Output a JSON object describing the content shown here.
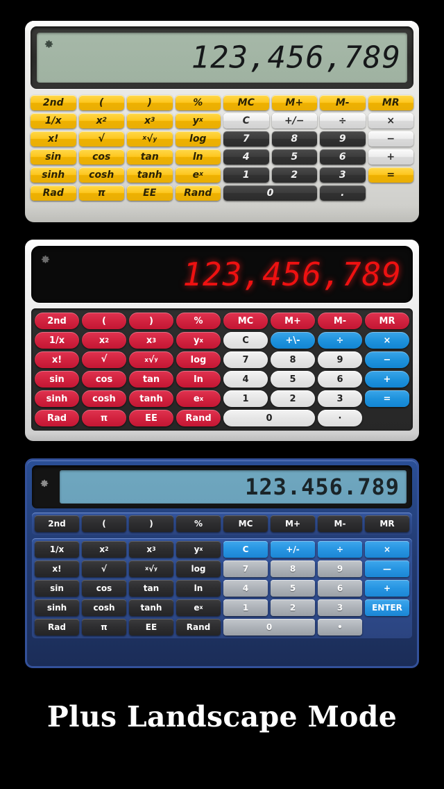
{
  "caption": "Plus Landscape Mode",
  "calculators": [
    {
      "theme": "silver",
      "display_value": "123,456,789",
      "gear_icon": "gear-icon",
      "keys": {
        "row1": [
          "2nd",
          "(",
          ")",
          "%",
          "MC",
          "M+",
          "M-",
          "MR"
        ],
        "row2": [
          "1/x",
          "x2",
          "x3",
          "yx",
          "C",
          "+/−",
          "÷",
          "×"
        ],
        "row3": [
          "x!",
          "√",
          "x√y",
          "log",
          "7",
          "8",
          "9",
          "−"
        ],
        "row4": [
          "sin",
          "cos",
          "tan",
          "ln",
          "4",
          "5",
          "6",
          "+"
        ],
        "row5": [
          "sinh",
          "cosh",
          "tanh",
          "ex",
          "1",
          "2",
          "3",
          "="
        ],
        "row6": [
          "Rad",
          "π",
          "EE",
          "Rand",
          "0",
          "."
        ]
      },
      "labels": {
        "second": "2nd",
        "open_paren": "(",
        "close_paren": ")",
        "percent": "%",
        "mc": "MC",
        "mplus": "M+",
        "mminus": "M-",
        "mr": "MR",
        "reciprocal": "1/x",
        "square_base": "x",
        "square_exp": "2",
        "cube_base": "x",
        "cube_exp": "3",
        "power_base": "y",
        "power_exp": "x",
        "clear": "C",
        "sign": "+/−",
        "divide": "÷",
        "multiply": "×",
        "factorial": "x!",
        "sqrt": "√",
        "nroot_pre": "x",
        "nroot_mid": "√",
        "nroot_post": "y",
        "log": "log",
        "seven": "7",
        "eight": "8",
        "nine": "9",
        "minus": "−",
        "sin": "sin",
        "cos": "cos",
        "tan": "tan",
        "ln": "ln",
        "four": "4",
        "five": "5",
        "six": "6",
        "plus": "+",
        "sinh": "sinh",
        "cosh": "cosh",
        "tanh": "tanh",
        "exp_base": "e",
        "exp_exp": "x",
        "one": "1",
        "two": "2",
        "three": "3",
        "equals": "=",
        "rad": "Rad",
        "pi": "π",
        "ee": "EE",
        "rand": "Rand",
        "zero": "0",
        "dot": "."
      }
    },
    {
      "theme": "white-red",
      "display_value": "123,456,789",
      "gear_icon": "gear-icon",
      "labels": {
        "second": "2nd",
        "open_paren": "(",
        "close_paren": ")",
        "percent": "%",
        "mc": "MC",
        "mplus": "M+",
        "mminus": "M-",
        "mr": "MR",
        "reciprocal": "1/x",
        "square_base": "x",
        "square_exp": "2",
        "cube_base": "x",
        "cube_exp": "3",
        "power_base": "y",
        "power_exp": "x",
        "clear": "C",
        "sign": "+\\-",
        "divide": "÷",
        "multiply": "×",
        "factorial": "x!",
        "sqrt": "√",
        "nroot_pre": "x",
        "nroot_mid": "√",
        "nroot_post": "y",
        "log": "log",
        "seven": "7",
        "eight": "8",
        "nine": "9",
        "minus": "−",
        "sin": "sin",
        "cos": "cos",
        "tan": "tan",
        "ln": "ln",
        "four": "4",
        "five": "5",
        "six": "6",
        "plus": "+",
        "sinh": "sinh",
        "cosh": "cosh",
        "tanh": "tanh",
        "exp_base": "e",
        "exp_exp": "x",
        "one": "1",
        "two": "2",
        "three": "3",
        "equals": "=",
        "rad": "Rad",
        "pi": "π",
        "ee": "EE",
        "rand": "Rand",
        "zero": "0",
        "dot": "·"
      }
    },
    {
      "theme": "blue",
      "display_value": "123.456.789",
      "gear_icon": "gear-icon",
      "labels": {
        "second": "2nd",
        "open_paren": "(",
        "close_paren": ")",
        "percent": "%",
        "mc": "MC",
        "mplus": "M+",
        "mminus": "M-",
        "mr": "MR",
        "reciprocal": "1/x",
        "square_base": "x",
        "square_exp": "2",
        "cube_base": "x",
        "cube_exp": "3",
        "power_base": "y",
        "power_exp": "x",
        "clear": "C",
        "sign": "+/-",
        "divide": "÷",
        "multiply": "×",
        "factorial": "x!",
        "sqrt": "√",
        "nroot_pre": "x",
        "nroot_mid": "√",
        "nroot_post": "y",
        "log": "log",
        "seven": "7",
        "eight": "8",
        "nine": "9",
        "minus": "—",
        "sin": "sin",
        "cos": "cos",
        "tan": "tan",
        "ln": "ln",
        "four": "4",
        "five": "5",
        "six": "6",
        "plus": "+",
        "sinh": "sinh",
        "cosh": "cosh",
        "tanh": "tanh",
        "exp_base": "e",
        "exp_exp": "x",
        "one": "1",
        "two": "2",
        "three": "3",
        "equals": "ENTER",
        "rad": "Rad",
        "pi": "π",
        "ee": "EE",
        "rand": "Rand",
        "zero": "0",
        "dot": "•"
      }
    }
  ],
  "colors": {
    "background": "#000000",
    "silver_body": "#e3e3e0",
    "silver_accent": "#fdc71f",
    "silver_lcd": "#a6b8a8",
    "white_body": "#e6e6e6",
    "white_accent": "#d2233f",
    "white_op": "#1f93dd",
    "white_lcd_text": "#ee1111",
    "blue_body": "#22396e",
    "blue_accent": "#2795e2",
    "blue_lcd": "#6fa7bf",
    "caption_text": "#ffffff"
  }
}
